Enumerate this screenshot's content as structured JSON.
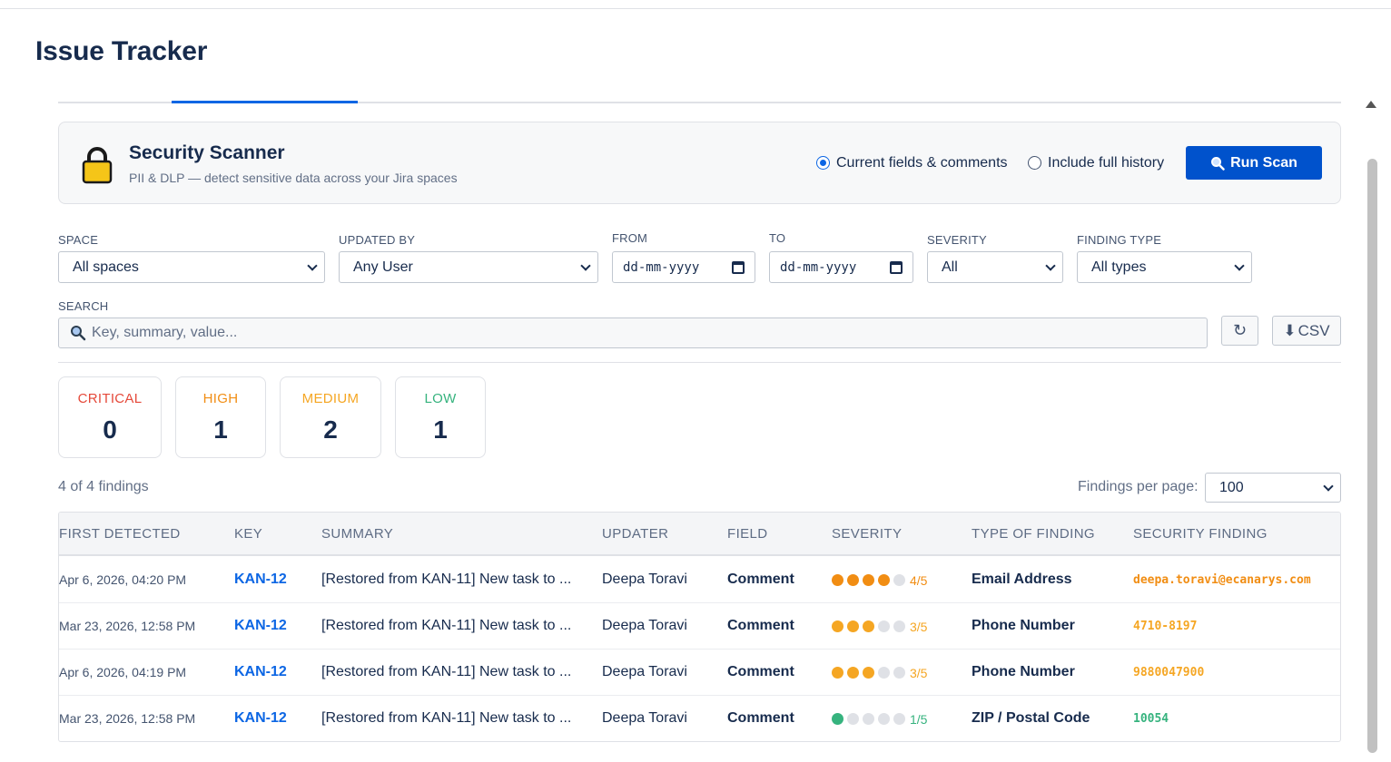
{
  "app": {
    "title": "Issue Tracker"
  },
  "scanner": {
    "icon": "lock-icon",
    "title": "Security Scanner",
    "subtitle": "PII & DLP — detect sensitive data across your Jira spaces",
    "scope_options": [
      {
        "label": "Current fields & comments",
        "selected": true
      },
      {
        "label": "Include full history",
        "selected": false
      }
    ],
    "run_label": "Run Scan"
  },
  "filters": {
    "space": {
      "label": "SPACE",
      "value": "All spaces"
    },
    "updated_by": {
      "label": "UPDATED BY",
      "value": "Any User"
    },
    "from": {
      "label": "FROM",
      "placeholder": "dd-mm-yyyy"
    },
    "to": {
      "label": "TO",
      "placeholder": "dd-mm-yyyy"
    },
    "severity": {
      "label": "SEVERITY",
      "value": "All"
    },
    "finding_type": {
      "label": "FINDING TYPE",
      "value": "All types"
    },
    "search": {
      "label": "SEARCH",
      "placeholder": "Key, summary, value..."
    },
    "refresh_icon": "↻",
    "csv_label": "CSV"
  },
  "summary": [
    {
      "label": "CRITICAL",
      "count": "0",
      "color": "#e5493a"
    },
    {
      "label": "HIGH",
      "count": "1",
      "color": "#f18d13"
    },
    {
      "label": "MEDIUM",
      "count": "2",
      "color": "#f5a623"
    },
    {
      "label": "LOW",
      "count": "1",
      "color": "#36b37e"
    }
  ],
  "results": {
    "count_text": "4 of 4 findings",
    "per_page_label": "Findings per page:",
    "per_page_value": "100"
  },
  "table": {
    "columns": [
      "FIRST DETECTED",
      "KEY",
      "SUMMARY",
      "UPDATER",
      "FIELD",
      "SEVERITY",
      "TYPE OF FINDING",
      "SECURITY FINDING"
    ],
    "rows": [
      {
        "first_detected": "Apr 6, 2026, 04:20 PM",
        "key": "KAN-12",
        "summary": "[Restored from KAN-11] New task to ...",
        "updater": "Deepa Toravi",
        "field": "Comment",
        "severity_score": 4,
        "severity_text": "4/5",
        "severity_color": "#f18d13",
        "finding_type": "Email Address",
        "finding": "deepa.toravi@ecanarys.com",
        "finding_color": "#f18d13"
      },
      {
        "first_detected": "Mar 23, 2026, 12:58 PM",
        "key": "KAN-12",
        "summary": "[Restored from KAN-11] New task to ...",
        "updater": "Deepa Toravi",
        "field": "Comment",
        "severity_score": 3,
        "severity_text": "3/5",
        "severity_color": "#f5a623",
        "finding_type": "Phone Number",
        "finding": "4710-8197",
        "finding_color": "#f5a623"
      },
      {
        "first_detected": "Apr 6, 2026, 04:19 PM",
        "key": "KAN-12",
        "summary": "[Restored from KAN-11] New task to ...",
        "updater": "Deepa Toravi",
        "field": "Comment",
        "severity_score": 3,
        "severity_text": "3/5",
        "severity_color": "#f5a623",
        "finding_type": "Phone Number",
        "finding": "9880047900",
        "finding_color": "#f5a623"
      },
      {
        "first_detected": "Mar 23, 2026, 12:58 PM",
        "key": "KAN-12",
        "summary": "[Restored from KAN-11] New task to ...",
        "updater": "Deepa Toravi",
        "field": "Comment",
        "severity_score": 1,
        "severity_text": "1/5",
        "severity_color": "#36b37e",
        "finding_type": "ZIP / Postal Code",
        "finding": "10054",
        "finding_color": "#36b37e"
      }
    ]
  }
}
